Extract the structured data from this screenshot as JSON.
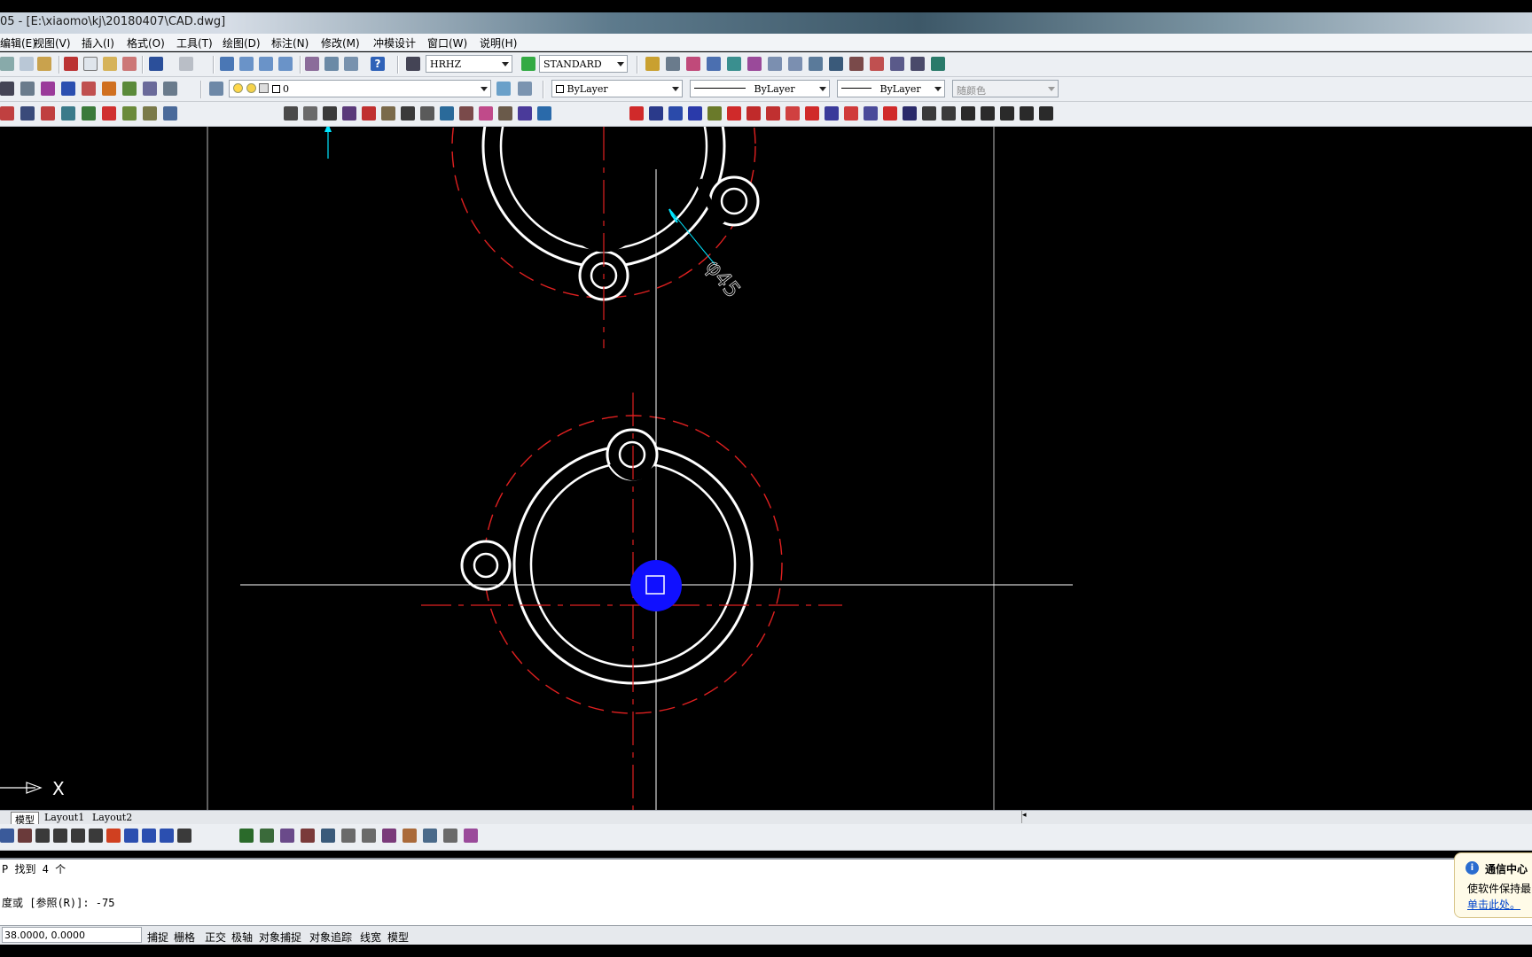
{
  "window": {
    "title": "05 - [E:\\xiaomo\\kj\\20180407\\CAD.dwg]"
  },
  "menu": [
    "编辑(E)",
    "视图(V)",
    "插入(I)",
    "格式(O)",
    "工具(T)",
    "绘图(D)",
    "标注(N)",
    "修改(M)",
    "冲模设计",
    "窗口(W)",
    "说明(H)"
  ],
  "toolbar": {
    "text_style": "HRHZ",
    "dim_style": "STANDARD",
    "layer": "0",
    "color": "ByLayer",
    "linetype": "ByLayer",
    "lineweight": "ByLayer",
    "plot_style": "随颜色"
  },
  "drawing": {
    "dimension_text": "φ45",
    "ucs_axis_label": "X"
  },
  "tabs": [
    "模型",
    "Layout1",
    "Layout2"
  ],
  "command": {
    "line1": "P 找到 4 个",
    "line2": "度或 [参照(R)]: -75"
  },
  "status": {
    "coords": "38.0000, 0.0000",
    "toggles": [
      "捕捉",
      "栅格",
      "正交",
      "极轴",
      "对象捕捉",
      "对象追踪",
      "线宽",
      "模型"
    ]
  },
  "notification": {
    "title": "通信中心",
    "body": "使软件保持最",
    "link": "单击此处。"
  },
  "colors": {
    "entity": "#ffffff",
    "centerline": "#e02020",
    "grip": "#1010ff",
    "dimension": "#00e5ff"
  }
}
